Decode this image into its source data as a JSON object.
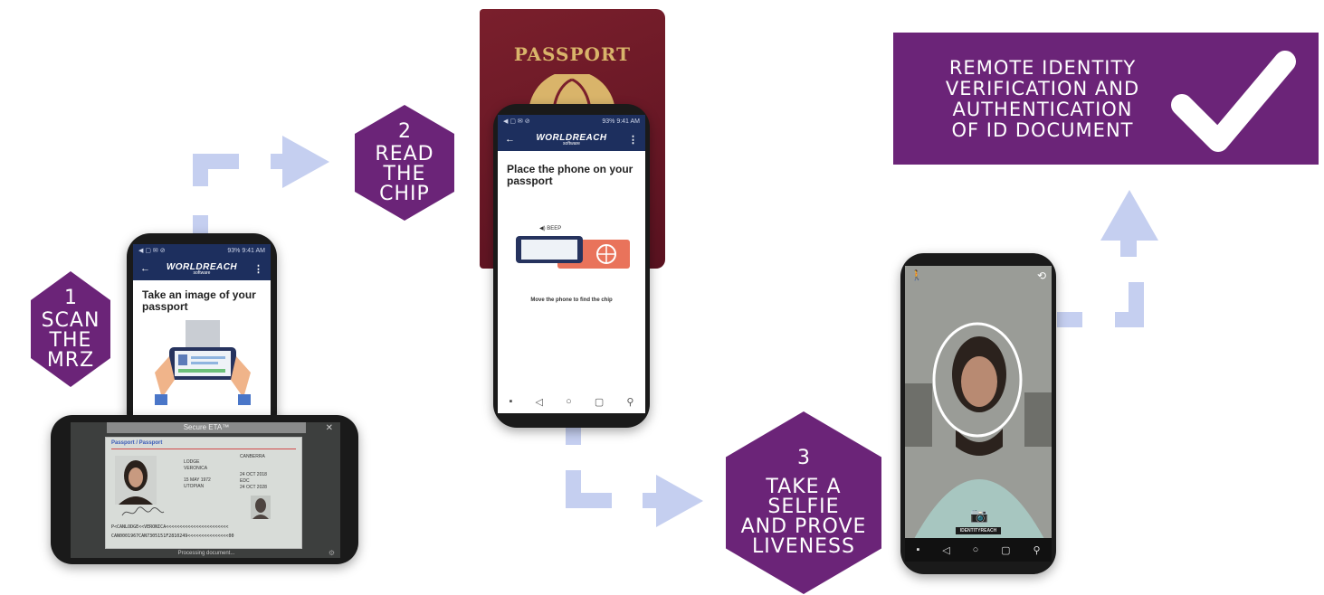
{
  "steps": [
    {
      "number": "1",
      "lines": [
        "SCAN",
        "THE",
        "MRZ"
      ]
    },
    {
      "number": "2",
      "lines": [
        "READ",
        "THE",
        "CHIP"
      ]
    },
    {
      "number": "3",
      "lines": [
        "TAKE A",
        "SELFIE",
        "AND PROVE",
        "LIVENESS"
      ]
    }
  ],
  "result": {
    "lines": [
      "REMOTE IDENTITY",
      "VERIFICATION AND",
      "AUTHENTICATION",
      "OF ID DOCUMENT"
    ]
  },
  "phone1": {
    "status": "93% 9:41 AM",
    "brand": "WORLDREACH",
    "brand_sub": "software",
    "title": "Take an image of your passport"
  },
  "scanner": {
    "header": "Secure ETA™",
    "doc_label": "Passport / Passport",
    "surname": "LODGE",
    "given_name": "VERONICA",
    "dob": "15 MAY 1972",
    "nationality": "UTOPIAN",
    "issue_date": "24 OCT 2018",
    "expiry_date": "24 OCT 2028",
    "authority": "EDC",
    "place": "CANBERRA",
    "mrz1": "P<CANLODGE<<VERONICA<<<<<<<<<<<<<<<<<<<<<<<",
    "mrz2": "CAN0001967CAN7305151F2810249<<<<<<<<<<<<<<<00",
    "processing": "Processing document..."
  },
  "passport": {
    "title": "PASSPORT"
  },
  "phone2": {
    "status": "93% 9:41 AM",
    "brand": "WORLDREACH",
    "brand_sub": "software",
    "title": "Place the phone on your passport",
    "beep": "BEEP",
    "hint": "Move the phone to find the chip"
  },
  "phone3": {
    "watermark": "IDENTITYREACH"
  },
  "colors": {
    "purple": "#6b2478",
    "arrow": "#c5cff0",
    "navy": "#1d2f5e"
  }
}
